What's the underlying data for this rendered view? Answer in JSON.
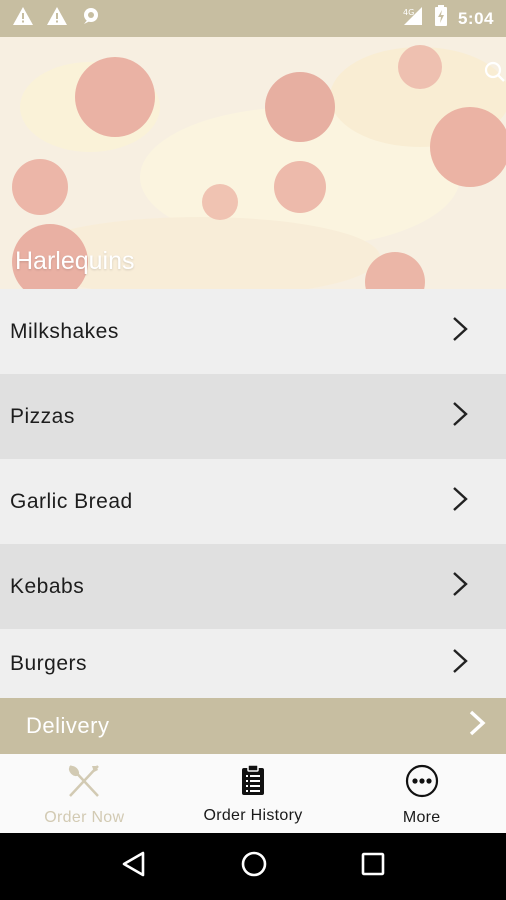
{
  "status_bar": {
    "time": "5:04",
    "network": "4G",
    "icons": [
      "warning-icon",
      "warning-icon",
      "notification-icon",
      "signal-icon",
      "battery-icon"
    ]
  },
  "hero": {
    "title": "Harlequins",
    "search_icon": "search-icon"
  },
  "categories": [
    {
      "label": "Milkshakes"
    },
    {
      "label": "Pizzas"
    },
    {
      "label": "Garlic Bread"
    },
    {
      "label": "Kebabs"
    },
    {
      "label": "Burgers"
    }
  ],
  "delivery": {
    "label": "Delivery"
  },
  "tabs": [
    {
      "label": "Order Now",
      "icon": "fork-knife-icon",
      "active": false
    },
    {
      "label": "Order History",
      "icon": "clipboard-icon",
      "active": true
    },
    {
      "label": "More",
      "icon": "more-icon",
      "active": true
    }
  ],
  "colors": {
    "accent": "#c7bea1",
    "inactive_tab": "#d2cab3"
  }
}
